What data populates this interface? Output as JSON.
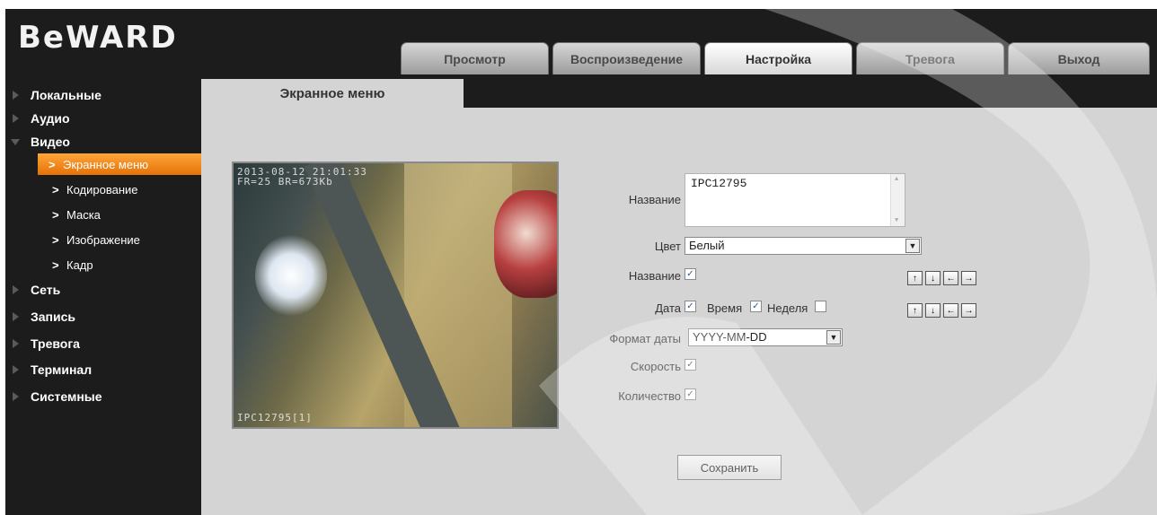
{
  "header": {
    "logo": "BeWARD",
    "tabs": [
      {
        "label": "Просмотр"
      },
      {
        "label": "Воспроизведение"
      },
      {
        "label": "Настройка",
        "active": true
      },
      {
        "label": "Тревога"
      },
      {
        "label": "Выход"
      }
    ]
  },
  "sidebar": {
    "items": [
      {
        "label": "Локальные"
      },
      {
        "label": "Аудио"
      },
      {
        "label": "Видео",
        "open": true
      },
      {
        "label": "Сеть"
      },
      {
        "label": "Запись"
      },
      {
        "label": "Тревога"
      },
      {
        "label": "Терминал"
      },
      {
        "label": "Системные"
      }
    ],
    "sub_items": [
      {
        "label": "Экранное меню",
        "active": true
      },
      {
        "label": "Кодирование"
      },
      {
        "label": "Маска"
      },
      {
        "label": "Изображение"
      },
      {
        "label": "Кадр"
      }
    ],
    "chevron": ">"
  },
  "content": {
    "tab_title": "Экранное меню",
    "video_osd": {
      "line1": "2013-08-12 21:01:33",
      "line2": "FR=25 BR=673Kb",
      "bottom": "IPC12795[1]"
    },
    "form": {
      "name_label": "Название",
      "name_value": "IPC12795",
      "color_label": "Цвет",
      "color_value": "Белый",
      "name_show_label": "Название",
      "date_label": "Дата",
      "time_label": "Время",
      "week_label": "Неделя",
      "date_format_label": "Формат даты",
      "date_format_value": "YYYY-MM-DD",
      "speed_label": "Скорость",
      "count_label": "Количество",
      "save_label": "Сохранить",
      "checked_mark": "✓",
      "arrows": [
        "↑",
        "↓",
        "←",
        "→"
      ],
      "dropdown_icon": "▼"
    }
  },
  "colors": {
    "app_bg": "#1c1c1c",
    "content_bg": "#d4d4d4",
    "active_sub_item": "#f08a18",
    "checkbox_mark": "#2b5797"
  }
}
